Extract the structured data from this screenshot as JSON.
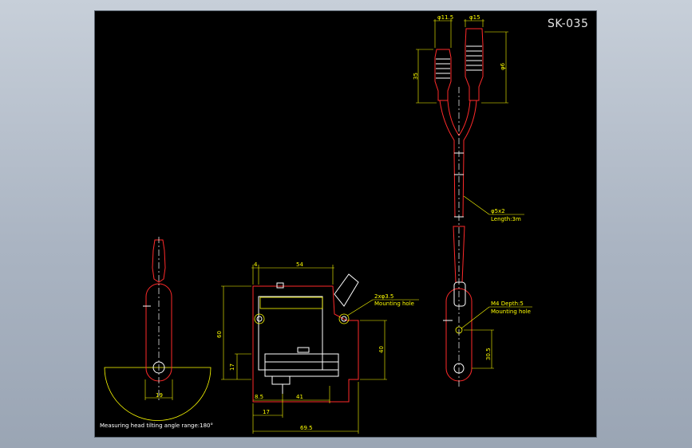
{
  "drawing_id": "SK-035",
  "side_view": {
    "width_dim": "19",
    "tilt_note": "Measuring head tilting angle range:180°"
  },
  "front_view": {
    "top_offset_dim": "4",
    "top_width_dim": "54",
    "height_dim": "60",
    "lower_height_dim": "40",
    "base_height_dim": "17",
    "hole_callout": "2xφ3.5",
    "hole_note": "Mounting hole",
    "small_offset_dim": "8.5",
    "inner_width_dim": "41",
    "bottom_offset_dim": "17",
    "overall_width_dim": "69.5"
  },
  "probe_view": {
    "plug1_dia": "φ11.5",
    "plug2_dia": "φ15",
    "plug_len_dim": "35",
    "plug2_dia_side": "φ6",
    "cable_spec": "φ5x2",
    "cable_length": "Length:3m",
    "thread_callout": "M4  Depth:5",
    "thread_note": "Mounting hole",
    "head_dim": "30.5"
  },
  "colors": {
    "background": "#000000",
    "outline": "#ff2a2a",
    "dimension": "#ffff00",
    "detail": "#ffffff"
  }
}
